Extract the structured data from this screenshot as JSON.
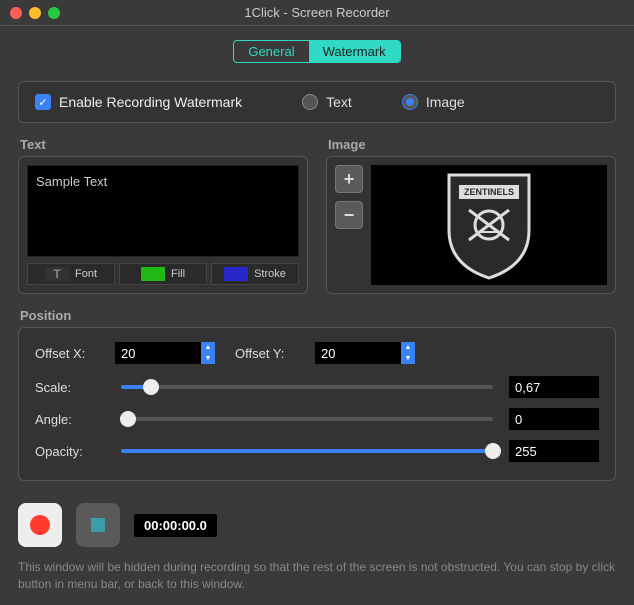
{
  "window": {
    "title": "1Click - Screen Recorder"
  },
  "tabs": {
    "general": "General",
    "watermark": "Watermark"
  },
  "enable": {
    "label": "Enable Recording Watermark"
  },
  "type": {
    "text": "Text",
    "image": "Image"
  },
  "sections": {
    "text": "Text",
    "image": "Image",
    "position": "Position"
  },
  "textPanel": {
    "sample": "Sample Text",
    "font": "Font",
    "fill": "Fill",
    "stroke": "Stroke"
  },
  "imagePanel": {
    "add": "+",
    "remove": "−",
    "logoText": "ZENTINELS"
  },
  "position": {
    "offsetXLabel": "Offset X:",
    "offsetX": "20",
    "offsetYLabel": "Offset Y:",
    "offsetY": "20",
    "scaleLabel": "Scale:",
    "scale": "0,67",
    "angleLabel": "Angle:",
    "angle": "0",
    "opacityLabel": "Opacity:",
    "opacity": "255"
  },
  "footer": {
    "timer": "00:00:00.0",
    "hint": "This window will be hidden during recording so that the rest of the screen is not obstructed. You can stop by click button in menu bar, or back to this window."
  }
}
